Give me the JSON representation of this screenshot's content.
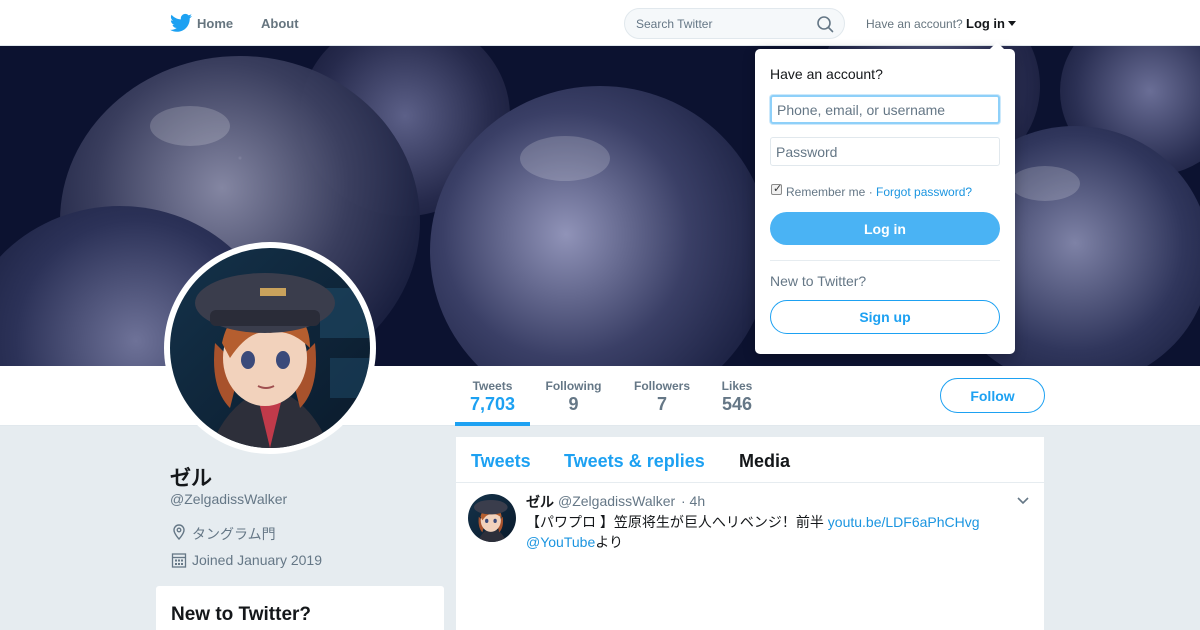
{
  "nav": {
    "home_label": "Home",
    "about_label": "About",
    "search_placeholder": "Search Twitter",
    "have_account_label": "Have an account?",
    "login_label": "Log in"
  },
  "profile": {
    "display_name": "ゼル",
    "handle": "@ZelgadissWalker",
    "location": "タングラム門",
    "joined": "Joined January 2019",
    "stats": [
      {
        "label": "Tweets",
        "value": "7,703"
      },
      {
        "label": "Following",
        "value": "9"
      },
      {
        "label": "Followers",
        "value": "7"
      },
      {
        "label": "Likes",
        "value": "546"
      }
    ],
    "follow_label": "Follow"
  },
  "sidebar": {
    "new_to_twitter_title": "New to Twitter?"
  },
  "timeline": {
    "tabs": [
      "Tweets",
      "Tweets & replies",
      "Media"
    ],
    "tweet": {
      "name": "ゼル",
      "handle": "@ZelgadissWalker",
      "time": "· 4h",
      "text_part1": "【パワプロ 】笠原将生が巨人へリベンジ！前半 ",
      "link1": "youtu.be/LDF6aPhCHvg",
      "mention": "@YouTube",
      "text_part2": "より"
    }
  },
  "login_dropdown": {
    "title": "Have an account?",
    "username_placeholder": "Phone, email, or username",
    "password_placeholder": "Password",
    "remember_label": "Remember me ·",
    "forgot_label": "Forgot password?",
    "login_button": "Log in",
    "new_label": "New to Twitter?",
    "signup_button": "Sign up"
  },
  "colors": {
    "accent": "#1da1f2",
    "login_button": "#4ab3f4",
    "page_bg": "#e6ecf0"
  },
  "icons": [
    "twitter-bird-icon",
    "search-icon",
    "caret-down-icon",
    "location-pin-icon",
    "calendar-icon",
    "chevron-down-icon"
  ]
}
